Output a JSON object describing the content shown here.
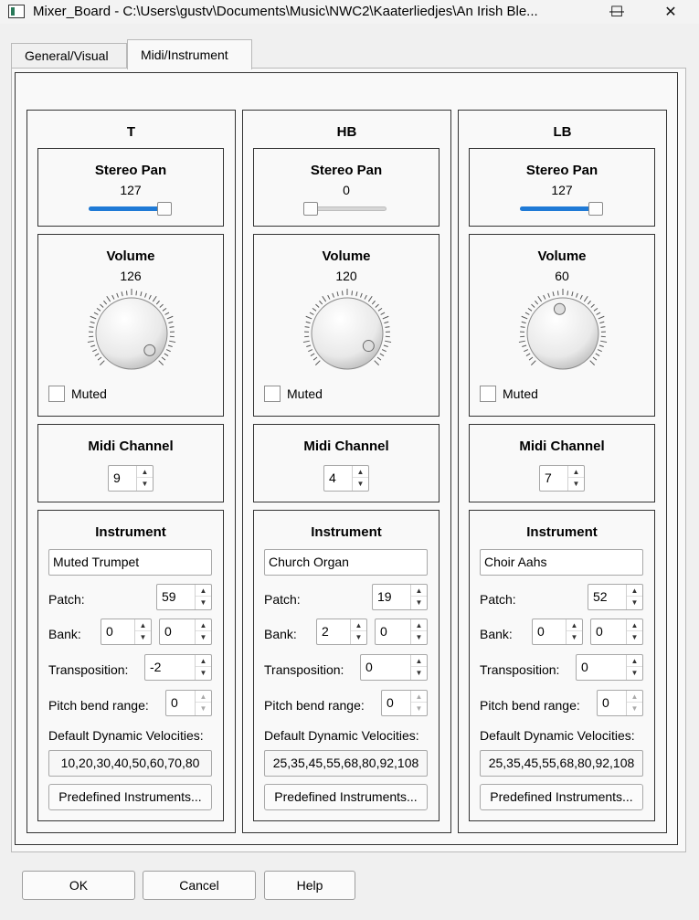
{
  "window": {
    "title": "Mixer_Board - C:\\Users\\gustv\\Documents\\Music\\NWC2\\Kaaterliedjes\\An Irish Ble...",
    "minimize": "—",
    "maximize": "☐",
    "close": "✕"
  },
  "tabs": [
    {
      "label": "General/Visual",
      "active": false
    },
    {
      "label": "Midi/Instrument",
      "active": true
    }
  ],
  "labels": {
    "stereo_pan": "Stereo Pan",
    "volume": "Volume",
    "muted": "Muted",
    "midi_channel": "Midi Channel",
    "instrument": "Instrument",
    "patch": "Patch:",
    "bank": "Bank:",
    "transposition": "Transposition:",
    "pitch_bend_range": "Pitch bend range:",
    "default_dynamic_velocities": "Default Dynamic Velocities:",
    "predefined_instruments": "Predefined Instruments..."
  },
  "staves": [
    {
      "name": "T",
      "stereo_pan": "127",
      "pan_level": 1.0,
      "volume": "126",
      "volume_level": 0.992,
      "muted": false,
      "midi_channel": "9",
      "instrument_name": "Muted Trumpet",
      "patch": "59",
      "bank_msb": "0",
      "bank_lsb": "0",
      "transposition": "-2",
      "pitch_bend_range": "0",
      "velocities": "10,20,30,40,50,60,70,80"
    },
    {
      "name": "HB",
      "stereo_pan": "0",
      "pan_level": 0.0,
      "volume": "120",
      "volume_level": 0.945,
      "muted": false,
      "midi_channel": "4",
      "instrument_name": "Church Organ",
      "patch": "19",
      "bank_msb": "2",
      "bank_lsb": "0",
      "transposition": "0",
      "pitch_bend_range": "0",
      "velocities": "25,35,45,55,68,80,92,108"
    },
    {
      "name": "LB",
      "stereo_pan": "127",
      "pan_level": 1.0,
      "volume": "60",
      "volume_level": 0.472,
      "muted": false,
      "midi_channel": "7",
      "instrument_name": "Choir Aahs",
      "patch": "52",
      "bank_msb": "0",
      "bank_lsb": "0",
      "transposition": "0",
      "pitch_bend_range": "0",
      "velocities": "25,35,45,55,68,80,92,108"
    }
  ],
  "buttons": {
    "ok": "OK",
    "cancel": "Cancel",
    "help": "Help"
  },
  "colors": {
    "accent": "#1f7ad6"
  }
}
